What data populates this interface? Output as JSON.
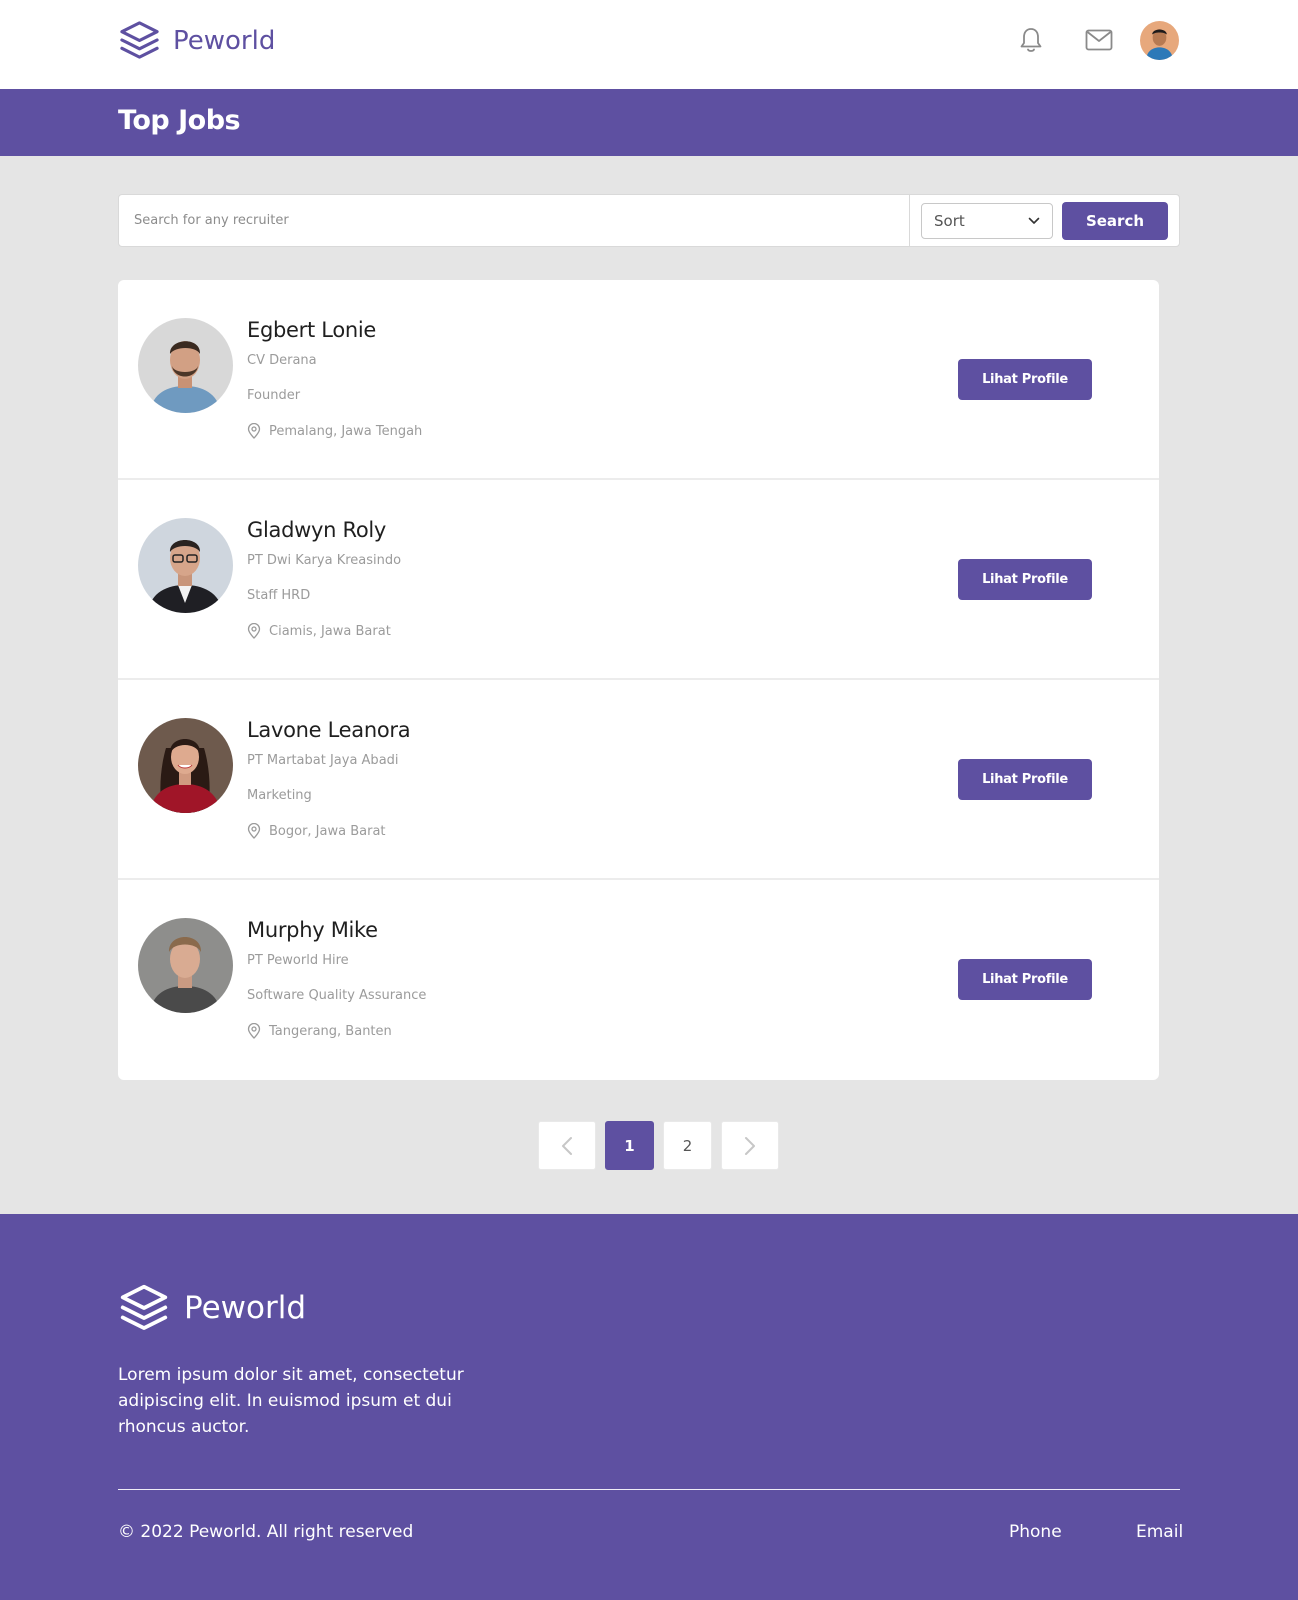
{
  "brand": {
    "name": "Peworld",
    "color": "#5e50a1"
  },
  "navbar": {
    "icons": [
      "bell-icon",
      "mail-icon"
    ]
  },
  "hero": {
    "title": "Top Jobs"
  },
  "search": {
    "placeholder": "Search for any recruiter",
    "sort_label": "Sort",
    "button_label": "Search"
  },
  "recruiters": [
    {
      "name": "Egbert Lonie",
      "company": "CV Derana",
      "role": "Founder",
      "location": "Pemalang, Jawa Tengah",
      "button_label": "Lihat Profile"
    },
    {
      "name": "Gladwyn Roly",
      "company": "PT Dwi Karya Kreasindo",
      "role": "Staff HRD",
      "location": "Ciamis, Jawa Barat",
      "button_label": "Lihat Profile"
    },
    {
      "name": "Lavone Leanora",
      "company": "PT Martabat Jaya Abadi",
      "role": "Marketing",
      "location": "Bogor, Jawa Barat",
      "button_label": "Lihat Profile"
    },
    {
      "name": "Murphy Mike",
      "company": "PT Peworld Hire",
      "role": "Software Quality Assurance",
      "location": "Tangerang, Banten",
      "button_label": "Lihat Profile"
    }
  ],
  "pagination": {
    "pages": [
      "1",
      "2"
    ],
    "current": "1"
  },
  "footer": {
    "brand": "Peworld",
    "description": "Lorem ipsum dolor sit amet, consectetur adipiscing elit. In euismod ipsum et dui rhoncus auctor.",
    "copyright": "© 2022 Peworld. All right reserved",
    "links": [
      "Phone",
      "Email"
    ]
  }
}
